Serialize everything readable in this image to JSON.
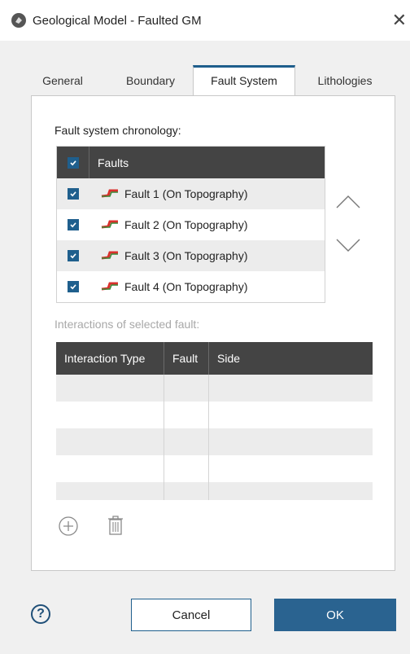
{
  "window": {
    "title": "Geological Model - Faulted GM",
    "close_label": "✕",
    "app_icon": "leapfrog-app-icon"
  },
  "tabs": [
    {
      "label": "General",
      "active": false
    },
    {
      "label": "Boundary",
      "active": false
    },
    {
      "label": "Fault System",
      "active": true
    },
    {
      "label": "Lithologies",
      "active": false
    }
  ],
  "fault_system": {
    "label": "Fault system chronology:",
    "header": "Faults",
    "header_checked": true,
    "rows": [
      {
        "name": "Fault 1 (On Topography)",
        "checked": true
      },
      {
        "name": "Fault 2 (On Topography)",
        "checked": true
      },
      {
        "name": "Fault 3 (On Topography)",
        "checked": true
      },
      {
        "name": "Fault 4 (On Topography)",
        "checked": true
      }
    ],
    "move_up_icon": "chevron-up-icon",
    "move_down_icon": "chevron-down-icon"
  },
  "interactions": {
    "label": "Interactions of selected fault:",
    "columns": [
      "Interaction Type",
      "Fault",
      "Side"
    ],
    "rows": [
      [],
      [],
      [],
      [],
      []
    ],
    "add_icon": "plus-circle-icon",
    "delete_icon": "trash-icon"
  },
  "footer": {
    "help_label": "?",
    "cancel_label": "Cancel",
    "ok_label": "OK"
  },
  "colors": {
    "accent": "#1f5f8d",
    "header_bg": "#444444",
    "ok_bg": "#2a6390"
  }
}
